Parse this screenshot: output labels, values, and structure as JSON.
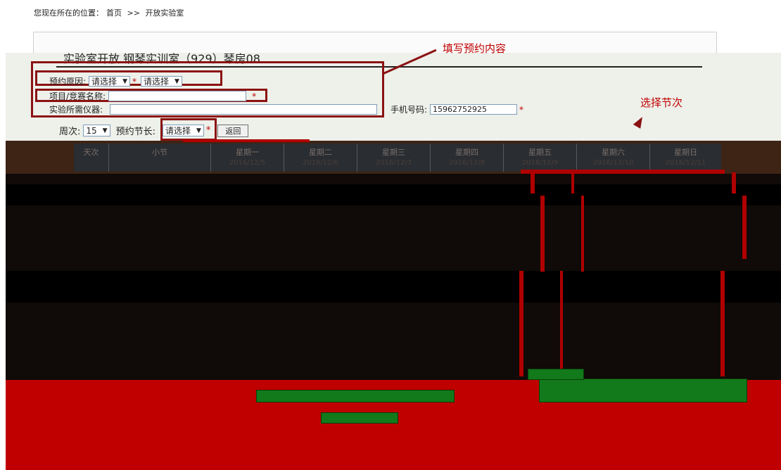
{
  "breadcrumb": {
    "prefix": "您现在所在的位置：",
    "home": "首页",
    "sep": ">>",
    "current": "开放实验室"
  },
  "title": "实验室开放   钢琴实训室（929）琴房08",
  "form": {
    "reason_label": "预约原因:",
    "reason_select_1": "请选择",
    "reason_select_2": "请选择",
    "project_label": "项目/竞赛名称:",
    "instrument_label": "实验所需仪器:",
    "phone_label": "手机号码:",
    "phone_value": "15962752925",
    "week_label": "周次:",
    "week_value": "15",
    "length_label": "预约节长:",
    "length_value": "请选择",
    "back_button": "返回",
    "required_mark": "*"
  },
  "annotations": {
    "fill_content": "填写预约内容",
    "select_section": "选择节次"
  },
  "grid": {
    "columns": [
      {
        "label": "天次",
        "date": ""
      },
      {
        "label": "小节",
        "date": ""
      },
      {
        "label": "星期一",
        "date": "2016/12/5"
      },
      {
        "label": "星期二",
        "date": "2016/12/6"
      },
      {
        "label": "星期三",
        "date": "2016/12/7"
      },
      {
        "label": "星期四",
        "date": "2016/12/8"
      },
      {
        "label": "星期五",
        "date": "2016/12/9"
      },
      {
        "label": "星期六",
        "date": "2016/12/10"
      },
      {
        "label": "星期日",
        "date": "2016/12/11"
      }
    ]
  },
  "colors": {
    "annotation_red": "#c00000",
    "highlight_border": "#8b1212",
    "foot_red": "#c00000"
  }
}
